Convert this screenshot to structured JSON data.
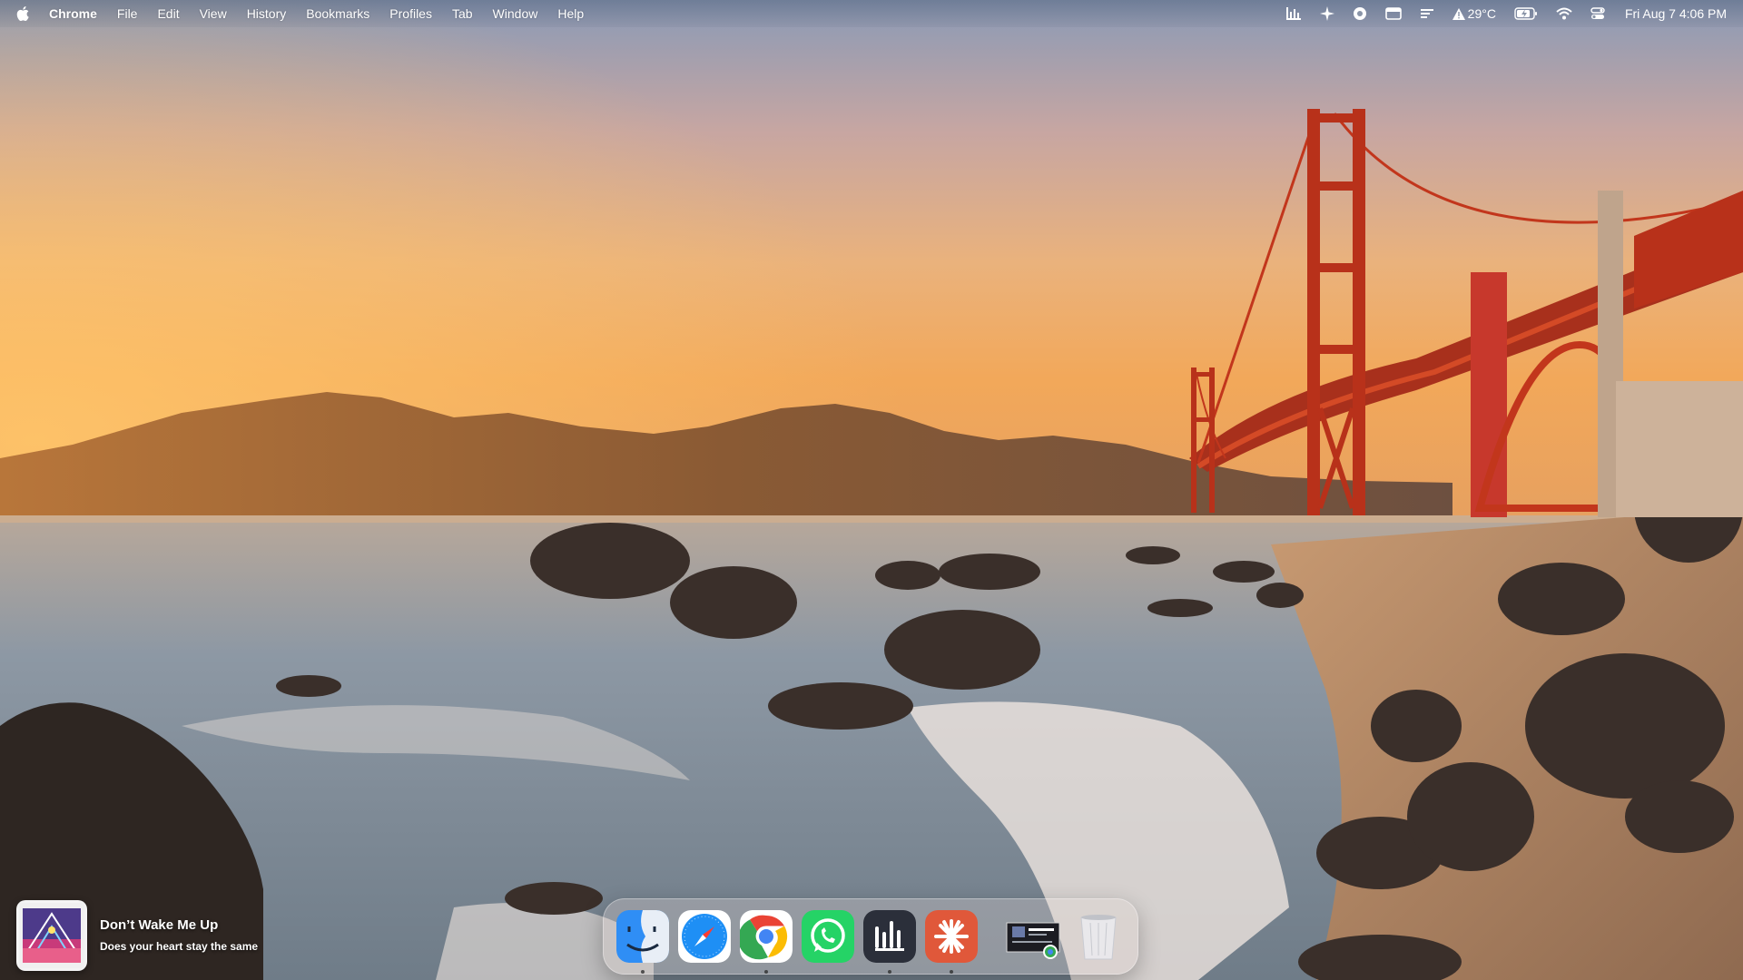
{
  "menubar": {
    "apple_icon": "apple-logo-icon",
    "app_name": "Chrome",
    "menus": [
      "File",
      "Edit",
      "View",
      "History",
      "Bookmarks",
      "Profiles",
      "Tab",
      "Window",
      "Help"
    ],
    "status": {
      "audio_icon": "audio-bars-icon",
      "sparkle_icon": "sparkle-icon",
      "circle_icon": "circle-status-icon",
      "calendar_icon": "calendar-card-icon",
      "notes_icon": "text-lines-icon",
      "weather_icon": "warning-triangle-icon",
      "weather_temp": "29°C",
      "battery_icon": "battery-charging-icon",
      "wifi_icon": "wifi-icon",
      "control_center_icon": "control-center-icon",
      "datetime": "Fri Aug 7  4:06 PM"
    }
  },
  "now_playing": {
    "title": "Don’t Wake Me Up",
    "subtitle": "Does your heart stay the same"
  },
  "dock": {
    "apps": [
      {
        "name": "finder-icon",
        "running": true
      },
      {
        "name": "safari-icon",
        "running": false
      },
      {
        "name": "chrome-icon",
        "running": true
      },
      {
        "name": "whatsapp-icon",
        "running": false
      },
      {
        "name": "audio-app-icon",
        "running": true
      },
      {
        "name": "claude-icon",
        "running": true
      }
    ],
    "recent_doc": "screenshot-document-icon",
    "trash": "trash-icon"
  },
  "colors": {
    "sky_top": "#8f9bb3",
    "sunset": "#f2b16a",
    "bridge": "#c2361c",
    "sea": "#7c8a96"
  }
}
